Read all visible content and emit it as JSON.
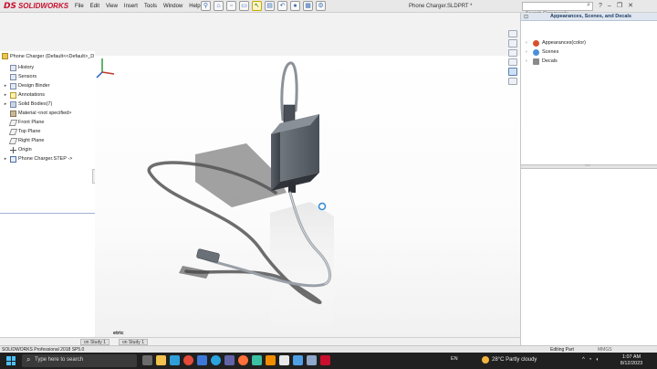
{
  "app": {
    "brand_mark": "DS",
    "brand_name": "SOLIDWORKS",
    "document_title": "Phone Charger.SLDPRT *"
  },
  "menu": [
    "File",
    "Edit",
    "View",
    "Insert",
    "Tools",
    "Window",
    "Help"
  ],
  "search": {
    "placeholder": "Search Commands"
  },
  "feature_tree": {
    "root_label": "Phone Charger (Default<<Default>_D",
    "items": [
      {
        "label": "History",
        "icon": "history-icon",
        "expandable": false
      },
      {
        "label": "Sensors",
        "icon": "sensor-icon",
        "expandable": false
      },
      {
        "label": "Design Binder",
        "icon": "binder-icon",
        "expandable": true
      },
      {
        "label": "Annotations",
        "icon": "annotations-icon",
        "expandable": true
      },
      {
        "label": "Solid Bodies(7)",
        "icon": "solid-bodies-icon",
        "expandable": true
      },
      {
        "label": "Material <not specified>",
        "icon": "material-icon",
        "expandable": false
      },
      {
        "label": "Front Plane",
        "icon": "plane-icon",
        "expandable": false
      },
      {
        "label": "Top Plane",
        "icon": "plane-icon",
        "expandable": false
      },
      {
        "label": "Right Plane",
        "icon": "plane-icon",
        "expandable": false
      },
      {
        "label": "Origin",
        "icon": "origin-icon",
        "expandable": false
      },
      {
        "label": "Phone Charger.STEP ->",
        "icon": "imported-body-icon",
        "expandable": true
      }
    ]
  },
  "viewport": {
    "view_label": "etric"
  },
  "bottom_tabs": [
    "on Study 1",
    "on Study 1"
  ],
  "task_pane": {
    "title": "Appearances, Scenes, and Decals",
    "items": [
      {
        "label": "Appearances(color)",
        "color": "#d9502f"
      },
      {
        "label": "Scenes",
        "color": "#4a90d9"
      },
      {
        "label": "Decals",
        "color": "#8a8a8a"
      }
    ]
  },
  "status_bar": {
    "left": "SOLIDWORKS Professional 2018 SP5.0",
    "mode": "Editing Part",
    "units": "MMGS"
  },
  "taskbar": {
    "search_placeholder": "Type here to search",
    "language": "EN",
    "weather": "28°C  Partly cloudy",
    "time": "1:07 AM",
    "date": "8/12/2023"
  },
  "colors": {
    "brand_red": "#c8102e",
    "taskbar_bg": "#202020",
    "viewport_bg": "#ffffff",
    "selection_marker": "#2e8bd6"
  }
}
